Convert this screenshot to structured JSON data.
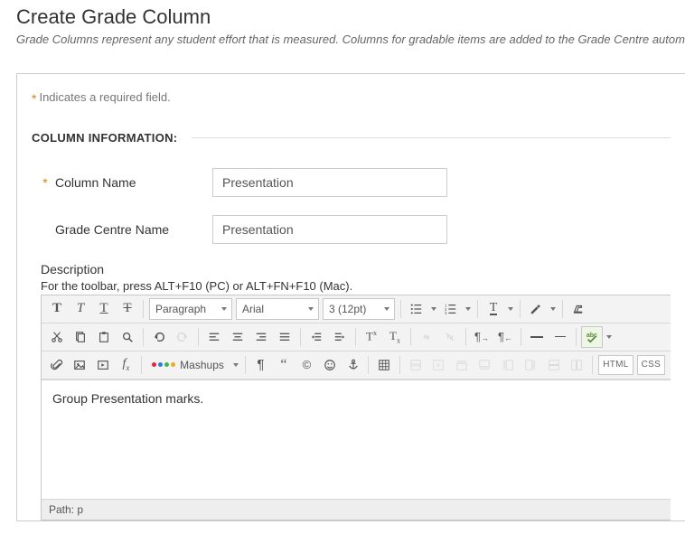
{
  "header": {
    "title": "Create Grade Column",
    "description": "Grade Columns represent any student effort that is measured. Columns for gradable items are added to the Grade Centre automatic"
  },
  "required_note": "Indicates a required field.",
  "section_heading": "COLUMN INFORMATION:",
  "fields": {
    "column_name": {
      "label": "Column Name",
      "value": "Presentation"
    },
    "grade_centre_name": {
      "label": "Grade Centre Name",
      "value": "Presentation"
    },
    "description_label": "Description",
    "toolbar_hint": "For the toolbar, press ALT+F10 (PC) or ALT+FN+F10 (Mac)."
  },
  "editor": {
    "format_select": "Paragraph",
    "font_family_select": "Arial",
    "font_size_select": "3 (12pt)",
    "mashups_label": "Mashups",
    "html_label": "HTML",
    "css_label": "CSS",
    "content": "Group Presentation marks.",
    "path_prefix": "Path: ",
    "path_value": "p"
  }
}
